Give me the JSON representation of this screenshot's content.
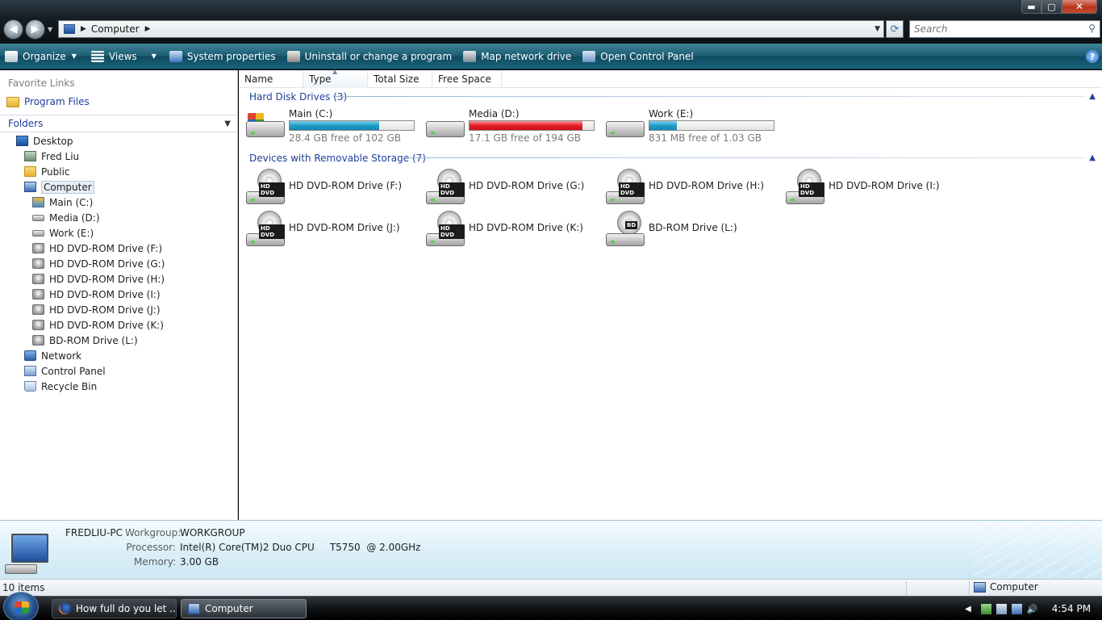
{
  "window": {
    "controls": {
      "minimize": "▬",
      "maximize": "▢",
      "close": "✕"
    }
  },
  "address": {
    "crumbs": [
      "Computer"
    ],
    "search_placeholder": "Search"
  },
  "toolbar": {
    "organize": "Organize",
    "views": "Views",
    "system_properties": "System properties",
    "uninstall": "Uninstall or change a program",
    "map_network": "Map network drive",
    "open_control_panel": "Open Control Panel",
    "help": "?"
  },
  "sidebar": {
    "favorite_links_heading": "Favorite Links",
    "favorite_links": [
      "Program Files"
    ],
    "folders_heading": "Folders",
    "tree": [
      {
        "label": "Desktop",
        "icon": "desktop-icon"
      },
      {
        "label": "Fred Liu",
        "icon": "user-folder-icon"
      },
      {
        "label": "Public",
        "icon": "folder-icon"
      },
      {
        "label": "Computer",
        "icon": "computer-icon",
        "selected": true
      },
      {
        "label": "Main (C:)",
        "icon": "system-drive-icon"
      },
      {
        "label": "Media (D:)",
        "icon": "hard-drive-icon"
      },
      {
        "label": "Work (E:)",
        "icon": "hard-drive-icon"
      },
      {
        "label": "HD DVD-ROM Drive (F:)",
        "icon": "optical-drive-icon"
      },
      {
        "label": "HD DVD-ROM Drive (G:)",
        "icon": "optical-drive-icon"
      },
      {
        "label": "HD DVD-ROM Drive (H:)",
        "icon": "optical-drive-icon"
      },
      {
        "label": "HD DVD-ROM Drive (I:)",
        "icon": "optical-drive-icon"
      },
      {
        "label": "HD DVD-ROM Drive (J:)",
        "icon": "optical-drive-icon"
      },
      {
        "label": "HD DVD-ROM Drive (K:)",
        "icon": "optical-drive-icon"
      },
      {
        "label": "BD-ROM Drive (L:)",
        "icon": "optical-drive-icon"
      },
      {
        "label": "Network",
        "icon": "network-icon"
      },
      {
        "label": "Control Panel",
        "icon": "control-panel-icon"
      },
      {
        "label": "Recycle Bin",
        "icon": "recycle-bin-icon"
      }
    ]
  },
  "columns": [
    "Name",
    "Type",
    "Total Size",
    "Free Space"
  ],
  "sorted_column": "Type",
  "hard_disk_group": {
    "heading": "Hard Disk Drives (3)",
    "drives": [
      {
        "name": "Main (C:)",
        "free_text": "28.4 GB free of 102 GB",
        "used_fraction": 0.72,
        "bar_color": "#1f9ec8"
      },
      {
        "name": "Media (D:)",
        "free_text": "17.1 GB free of 194 GB",
        "used_fraction": 0.91,
        "bar_color": "#e81b25"
      },
      {
        "name": "Work (E:)",
        "free_text": "831 MB free of 1.03 GB",
        "used_fraction": 0.22,
        "bar_color": "#1f9ec8"
      }
    ]
  },
  "removable_group": {
    "heading": "Devices with Removable Storage (7)",
    "drives": [
      {
        "name": "HD DVD-ROM Drive (F:)",
        "format": "HD DVD"
      },
      {
        "name": "HD DVD-ROM Drive (G:)",
        "format": "HD DVD"
      },
      {
        "name": "HD DVD-ROM Drive (H:)",
        "format": "HD DVD"
      },
      {
        "name": "HD DVD-ROM Drive (I:)",
        "format": "HD DVD"
      },
      {
        "name": "HD DVD-ROM Drive (J:)",
        "format": "HD DVD"
      },
      {
        "name": "HD DVD-ROM Drive (K:)",
        "format": "HD DVD"
      },
      {
        "name": "BD-ROM Drive (L:)",
        "format": "BD"
      }
    ]
  },
  "details": {
    "computer_name": "FREDLIU-PC",
    "workgroup_label": "Workgroup:",
    "workgroup": "WORKGROUP",
    "processor_label": "Processor:",
    "processor": "Intel(R) Core(TM)2 Duo CPU     T5750  @ 2.00GHz",
    "memory_label": "Memory:",
    "memory": "3.00 GB"
  },
  "status": {
    "item_count": "10 items",
    "location": "Computer"
  },
  "taskbar": {
    "tasks": [
      "How full do you let ...",
      "Computer"
    ],
    "clock": "4:54 PM"
  },
  "colors": {
    "accent_link": "#1e3e9c",
    "command_bar": "#1d5e74",
    "bar_blue": "#1f9ec8",
    "bar_red": "#e81b25"
  }
}
